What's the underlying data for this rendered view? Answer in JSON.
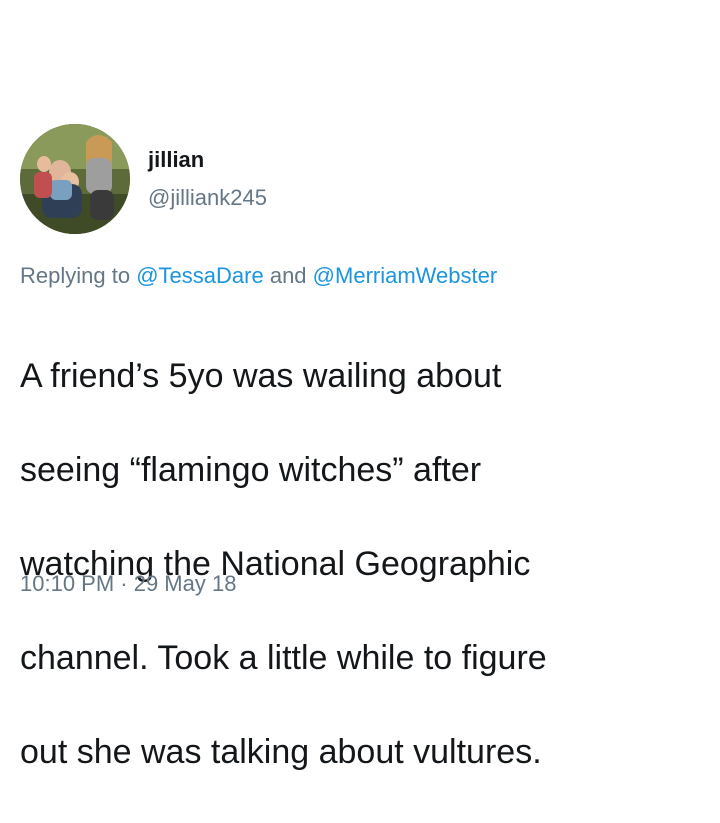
{
  "author": {
    "display_name": "jillian",
    "handle": "@jilliank245",
    "avatar_icon": "profile-photo-avatar"
  },
  "reply": {
    "prefix": "Replying to",
    "mention_1": "@TessaDare",
    "connector": "and",
    "mention_2": "@MerriamWebster"
  },
  "tweet": {
    "lines": [
      "A friend’s 5yo was wailing about",
      "seeing “flamingo witches” after",
      "watching the National Geographic",
      "channel. Took a little while to figure",
      "out she was talking about vultures."
    ],
    "timestamp": "10:10 PM · 29 May 18"
  },
  "colors": {
    "text": "#14171a",
    "secondary": "#657786",
    "link": "#1b95e0",
    "background": "#ffffff"
  }
}
